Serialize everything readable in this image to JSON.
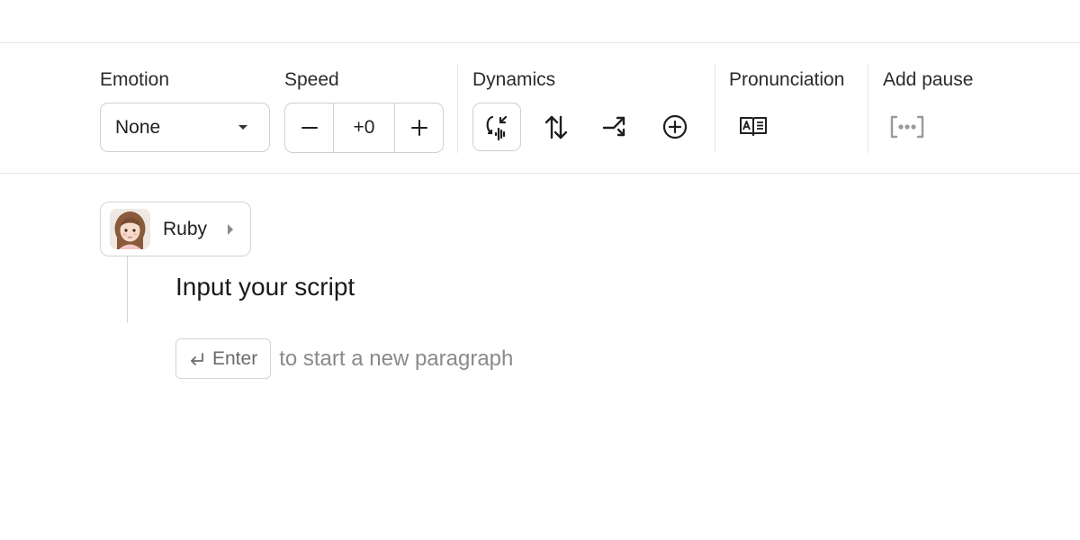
{
  "toolbar": {
    "emotion": {
      "label": "Emotion",
      "selected": "None"
    },
    "speed": {
      "label": "Speed",
      "value": "+0",
      "decrement_icon": "minus-icon",
      "increment_icon": "plus-icon"
    },
    "dynamics": {
      "label": "Dynamics",
      "buttons": [
        {
          "name": "voice-dynamics",
          "icon": "voice-dynamics-icon",
          "active": true
        },
        {
          "name": "pitch",
          "icon": "arrows-up-down-icon",
          "active": false
        },
        {
          "name": "transition",
          "icon": "arrow-turn-icon",
          "active": false
        },
        {
          "name": "add",
          "icon": "plus-circle-icon",
          "active": false
        }
      ]
    },
    "pronunciation": {
      "label": "Pronunciation",
      "icon": "book-icon"
    },
    "add_pause": {
      "label": "Add pause",
      "icon": "pause-bracket-icon"
    }
  },
  "editor": {
    "speaker": {
      "name": "Ruby"
    },
    "placeholder": "Input your script",
    "hint": {
      "key": "Enter",
      "text": "to start a new paragraph"
    }
  },
  "colors": {
    "border": "#cfcfcf",
    "muted": "#8a8a8a",
    "text": "#1f1f1f"
  }
}
